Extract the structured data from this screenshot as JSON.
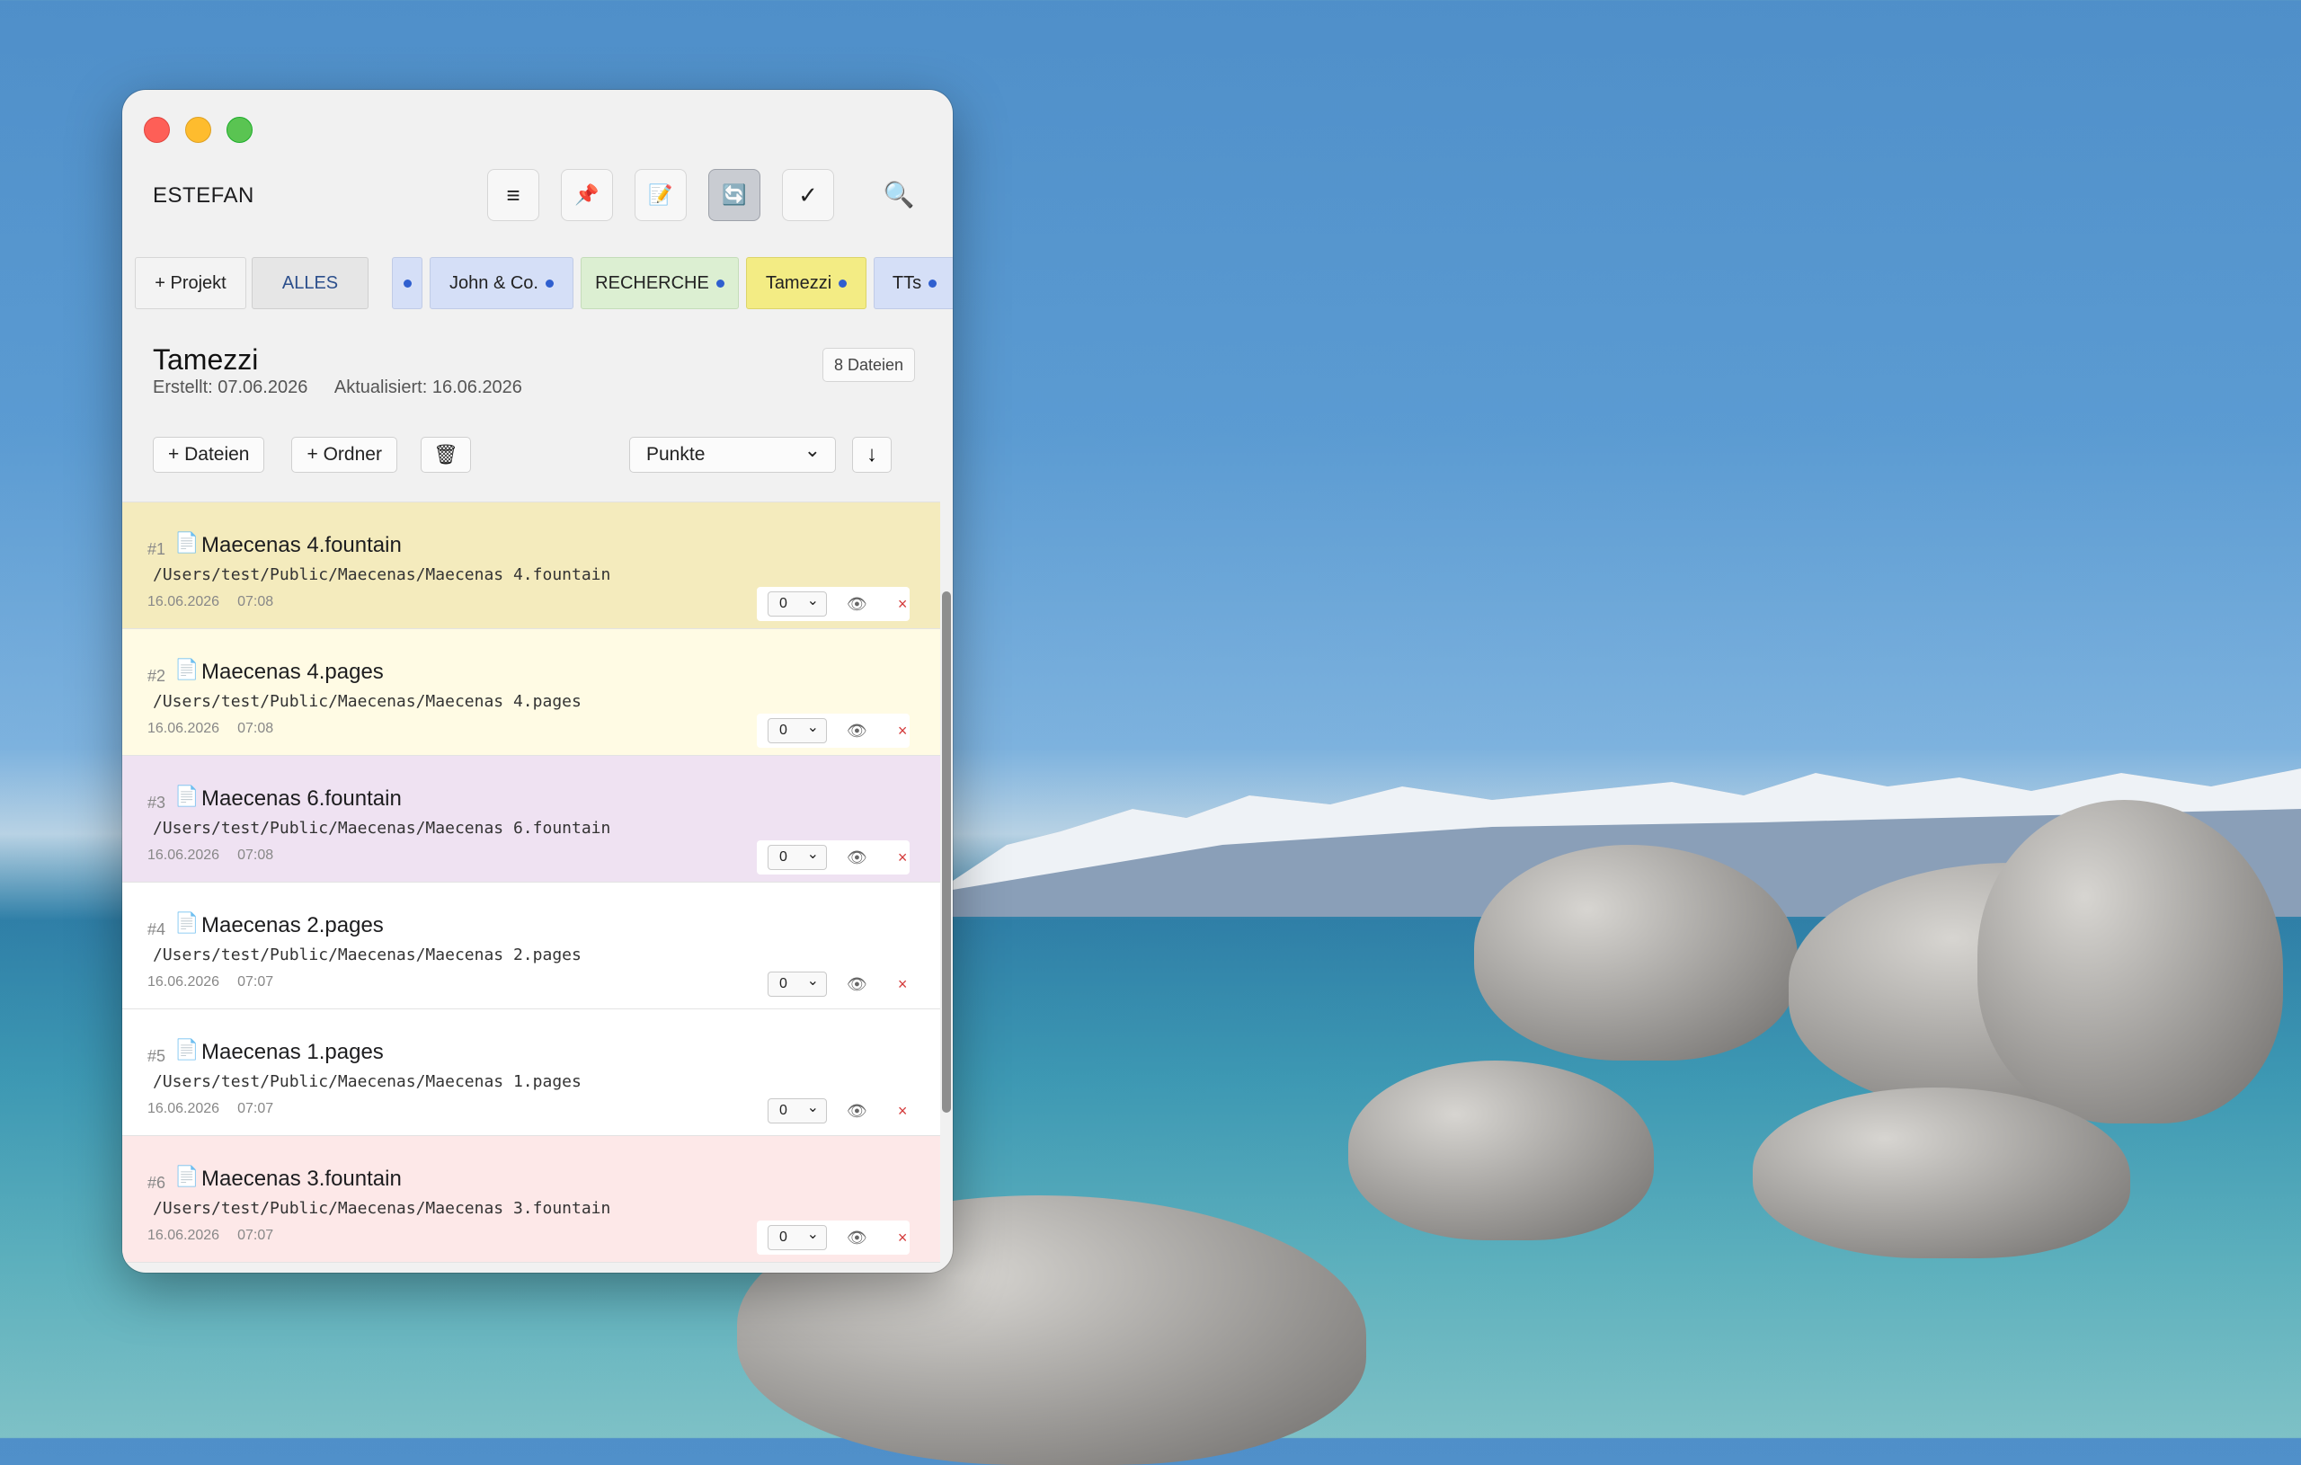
{
  "app": {
    "title": "ESTEFAN",
    "toolbar": {
      "menu_icon": "≡",
      "pin_icon": "📌",
      "note_icon": "📝",
      "refresh_icon": "🔄",
      "check_icon": "✓",
      "search_icon": "🔍"
    }
  },
  "tabs": {
    "add_project": "+ Projekt",
    "all": "ALLES",
    "items": [
      {
        "label": "",
        "color": "#d5dff7"
      },
      {
        "label": "John & Co.",
        "color": "#d5dff7"
      },
      {
        "label": "RECHERCHE",
        "color": "#dcefd2"
      },
      {
        "label": "Tamezzi",
        "color": "#f3ec84"
      },
      {
        "label": "TTs",
        "color": "#d5dff7"
      }
    ]
  },
  "project": {
    "title": "Tamezzi",
    "created": "Erstellt: 07.06.2026",
    "updated": "Aktualisiert: 16.06.2026",
    "file_count": "8 Dateien"
  },
  "actions": {
    "add_files": "+ Dateien",
    "add_folder": "+ Ordner",
    "trash_icon": "🗑",
    "sort_select": "Punkte",
    "sort_direction": "↓"
  },
  "files": [
    {
      "num": "#1",
      "name": "Maecenas 4.fountain",
      "path": "/Users/test/Public/Maecenas/Maecenas 4.fountain",
      "date": "16.06.2026",
      "time": "07:08",
      "points": "0",
      "bg": "#f4ebbd"
    },
    {
      "num": "#2",
      "name": "Maecenas 4.pages",
      "path": "/Users/test/Public/Maecenas/Maecenas 4.pages",
      "date": "16.06.2026",
      "time": "07:08",
      "points": "0",
      "bg": "#fffbe4"
    },
    {
      "num": "#3",
      "name": "Maecenas 6.fountain",
      "path": "/Users/test/Public/Maecenas/Maecenas 6.fountain",
      "date": "16.06.2026",
      "time": "07:08",
      "points": "0",
      "bg": "#efe2f2"
    },
    {
      "num": "#4",
      "name": "Maecenas 2.pages",
      "path": "/Users/test/Public/Maecenas/Maecenas 2.pages",
      "date": "16.06.2026",
      "time": "07:07",
      "points": "0",
      "bg": "#ffffff"
    },
    {
      "num": "#5",
      "name": "Maecenas 1.pages",
      "path": "/Users/test/Public/Maecenas/Maecenas 1.pages",
      "date": "16.06.2026",
      "time": "07:07",
      "points": "0",
      "bg": "#ffffff"
    },
    {
      "num": "#6",
      "name": "Maecenas 3.fountain",
      "path": "/Users/test/Public/Maecenas/Maecenas 3.fountain",
      "date": "16.06.2026",
      "time": "07:07",
      "points": "0",
      "bg": "#fde8e8"
    }
  ],
  "icons": {
    "file": "📄",
    "eye": "👁",
    "delete": "×",
    "chevron": "⌄"
  }
}
